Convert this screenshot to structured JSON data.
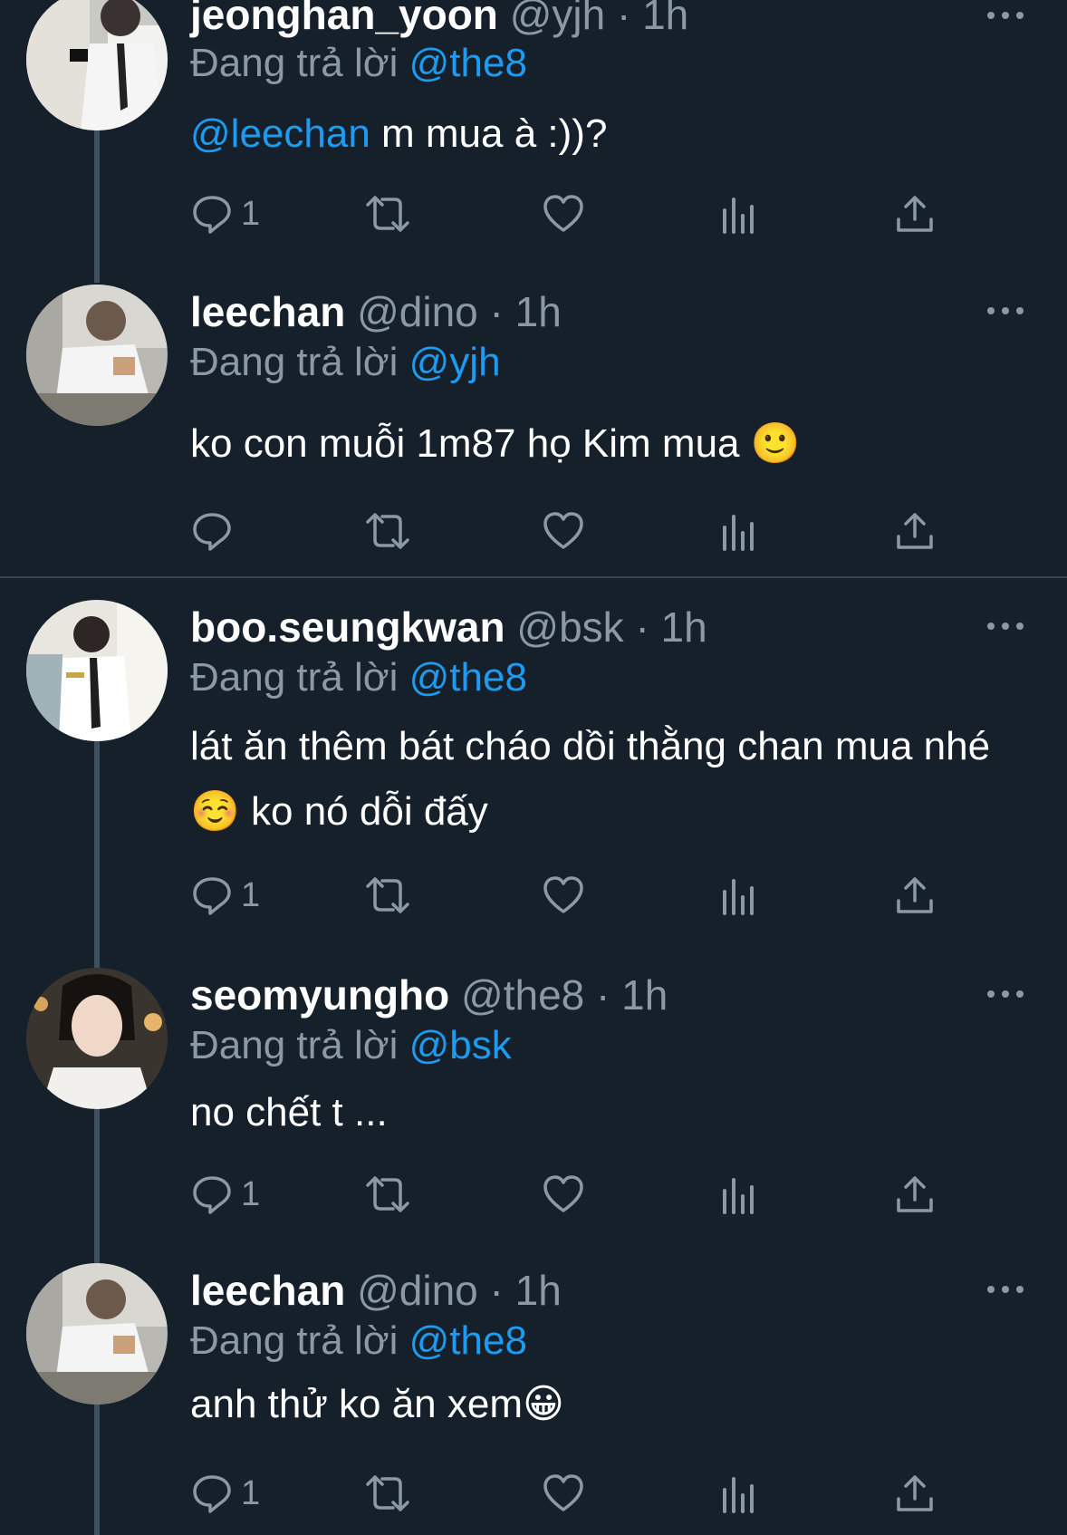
{
  "reply_prefix": "Đang trả lời",
  "colors": {
    "background": "#15202b",
    "mention": "#1d9bf0",
    "secondary": "#8b98a5",
    "thread_line": "#3d4f61"
  },
  "icons": {
    "reply": "reply-icon",
    "retweet": "retweet-icon",
    "like": "heart-icon",
    "views": "views-icon",
    "share": "share-icon",
    "more": "more-icon"
  },
  "tweets": [
    {
      "name": "jeonghan_yoon",
      "handle": "@yjh",
      "time": "1h",
      "replying_to": "@the8",
      "mention": "@leechan",
      "text": " m mua à :))?",
      "reply_count": "1"
    },
    {
      "name": "leechan",
      "handle": "@dino",
      "time": "1h",
      "replying_to": "@yjh",
      "text": "ko con muỗi 1m87 họ Kim mua 🙂",
      "reply_count": ""
    },
    {
      "name": "boo.seungkwan",
      "handle": "@bsk",
      "time": "1h",
      "replying_to": "@the8",
      "text": "lát ăn thêm bát cháo dồi thằng chan mua nhé ☺️ ko nó dỗi đấy",
      "reply_count": "1"
    },
    {
      "name": "seomyungho",
      "handle": "@the8",
      "time": "1h",
      "replying_to": "@bsk",
      "text": "no chết t ...",
      "reply_count": "1"
    },
    {
      "name": "leechan",
      "handle": "@dino",
      "time": "1h",
      "replying_to": "@the8",
      "text": "anh thử ko ăn xem😀",
      "reply_count": "1"
    }
  ]
}
